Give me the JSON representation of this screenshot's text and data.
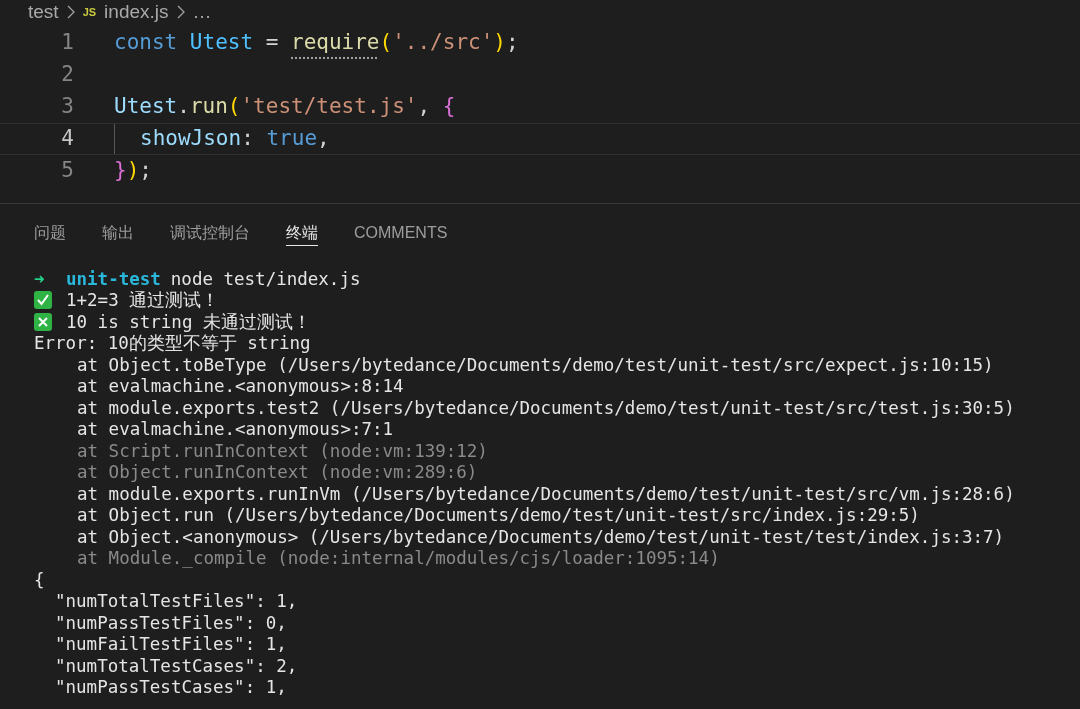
{
  "breadcrumb": [
    {
      "label": "test",
      "kind": "folder"
    },
    {
      "label": "index.js",
      "kind": "file",
      "badge": "JS"
    },
    {
      "label": "…",
      "kind": "more"
    }
  ],
  "editor": {
    "lines": [
      {
        "number": "1",
        "active": false,
        "indent": false,
        "tokens": [
          {
            "text": "const ",
            "kind": "keyword"
          },
          {
            "text": "Utest",
            "kind": "constant"
          },
          {
            "text": " = ",
            "kind": "plain"
          },
          {
            "text": "require",
            "kind": "function",
            "hint": true
          },
          {
            "text": "(",
            "kind": "bracket1"
          },
          {
            "text": "'../src'",
            "kind": "string"
          },
          {
            "text": ")",
            "kind": "bracket1"
          },
          {
            "text": ";",
            "kind": "plain"
          }
        ]
      },
      {
        "number": "2",
        "active": false
      },
      {
        "number": "3",
        "active": false,
        "indent": false,
        "tokens": [
          {
            "text": "Utest",
            "kind": "variable"
          },
          {
            "text": ".",
            "kind": "plain"
          },
          {
            "text": "run",
            "kind": "function"
          },
          {
            "text": "(",
            "kind": "bracket1"
          },
          {
            "text": "'test/test.js'",
            "kind": "string"
          },
          {
            "text": ", ",
            "kind": "plain"
          },
          {
            "text": "{",
            "kind": "bracket2"
          }
        ]
      },
      {
        "number": "4",
        "active": true,
        "indent": true,
        "tokens": [
          {
            "text": "showJson",
            "kind": "variable"
          },
          {
            "text": ": ",
            "kind": "plain"
          },
          {
            "text": "true",
            "kind": "keyword"
          },
          {
            "text": ",",
            "kind": "plain"
          }
        ]
      },
      {
        "number": "5",
        "active": false,
        "indent": false,
        "tokens": [
          {
            "text": "}",
            "kind": "bracket2"
          },
          {
            "text": ")",
            "kind": "bracket1"
          },
          {
            "text": ";",
            "kind": "plain"
          }
        ]
      }
    ]
  },
  "panel": {
    "tabs": [
      {
        "label": "问题",
        "selected": false
      },
      {
        "label": "输出",
        "selected": false
      },
      {
        "label": "调试控制台",
        "selected": false
      },
      {
        "label": "终端",
        "selected": true
      },
      {
        "label": "COMMENTS",
        "selected": false
      }
    ],
    "terminal": [
      {
        "kind": "prompt",
        "arrow": "➜",
        "dir": "unit-test",
        "text": "node test/index.js"
      },
      {
        "kind": "pass",
        "text": "1+2=3 通过测试！"
      },
      {
        "kind": "fail",
        "text": "10 is string 未通过测试！"
      },
      {
        "kind": "normal",
        "text": "Error: 10的类型不等于 string"
      },
      {
        "kind": "stack",
        "text": "at Object.toBeType (/Users/bytedance/Documents/demo/test/unit-test/src/expect.js:10:15)"
      },
      {
        "kind": "stack",
        "text": "at evalmachine.<anonymous>:8:14"
      },
      {
        "kind": "stack",
        "text": "at module.exports.test2 (/Users/bytedance/Documents/demo/test/unit-test/src/test.js:30:5)"
      },
      {
        "kind": "stack",
        "text": "at evalmachine.<anonymous>:7:1"
      },
      {
        "kind": "stack-dim",
        "text": "at Script.runInContext (node:vm:139:12)"
      },
      {
        "kind": "stack-dim",
        "text": "at Object.runInContext (node:vm:289:6)"
      },
      {
        "kind": "stack",
        "text": "at module.exports.runInVm (/Users/bytedance/Documents/demo/test/unit-test/src/vm.js:28:6)"
      },
      {
        "kind": "stack",
        "text": "at Object.run (/Users/bytedance/Documents/demo/test/unit-test/src/index.js:29:5)"
      },
      {
        "kind": "stack",
        "text": "at Object.<anonymous> (/Users/bytedance/Documents/demo/test/unit-test/test/index.js:3:7)"
      },
      {
        "kind": "stack-dim",
        "text": "at Module._compile (node:internal/modules/cjs/loader:1095:14)"
      },
      {
        "kind": "normal",
        "text": "{"
      },
      {
        "kind": "json",
        "text": "\"numTotalTestFiles\": 1,"
      },
      {
        "kind": "json",
        "text": "\"numPassTestFiles\": 0,"
      },
      {
        "kind": "json",
        "text": "\"numFailTestFiles\": 1,"
      },
      {
        "kind": "json",
        "text": "\"numTotalTestCases\": 2,"
      },
      {
        "kind": "json",
        "text": "\"numPassTestCases\": 1,"
      }
    ]
  }
}
